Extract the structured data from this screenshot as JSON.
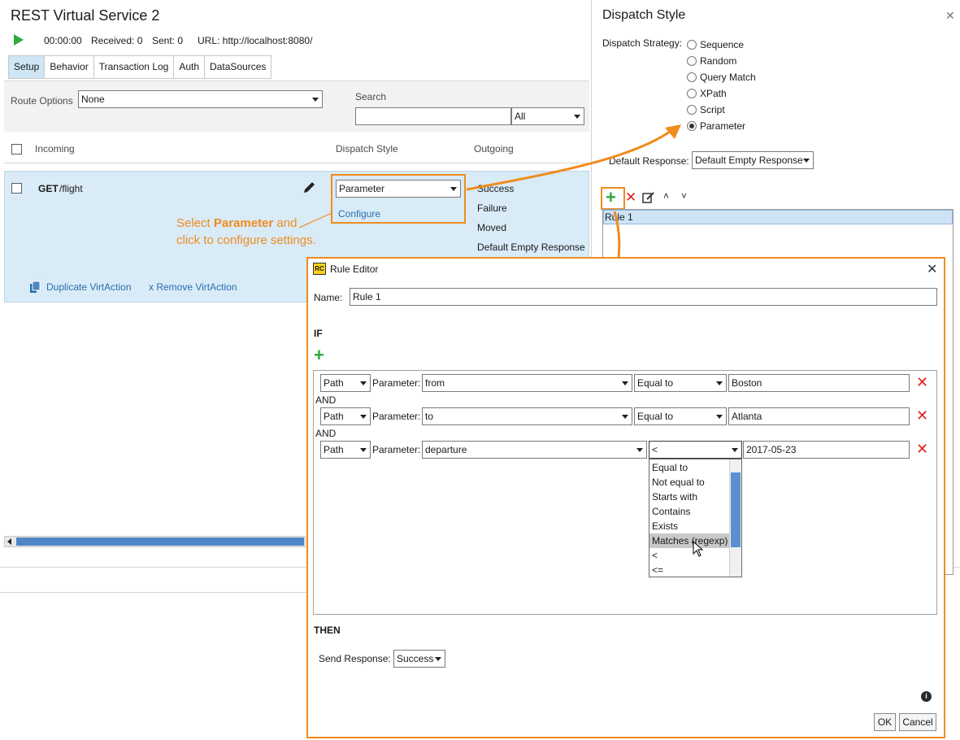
{
  "left": {
    "title": "REST Virtual Service 2",
    "status": {
      "time": "00:00:00",
      "received": "Received: 0",
      "sent": "Sent: 0",
      "url": "URL: http://localhost:8080/"
    },
    "tabs": [
      "Setup",
      "Behavior",
      "Transaction Log",
      "Auth",
      "DataSources"
    ],
    "route_options_label": "Route Options",
    "route_options_value": "None",
    "search_label": "Search",
    "search_value": "",
    "search_filter": "All",
    "columns": {
      "incoming": "Incoming",
      "dispatch": "Dispatch Style",
      "outgoing": "Outgoing"
    },
    "row": {
      "method": "GET",
      "path": "/flight",
      "dispatch_value": "Parameter",
      "configure": "Configure",
      "outgoing": [
        "Success",
        "Failure",
        "Moved",
        "Default Empty Response"
      ],
      "duplicate": "Duplicate VirtAction",
      "remove": "x Remove VirtAction"
    },
    "callout": {
      "pre": "Select ",
      "bold": "Parameter",
      "post": " and",
      "line2": "click to configure settings."
    }
  },
  "right": {
    "title": "Dispatch Style",
    "strategy_label": "Dispatch Strategy:",
    "strategies": [
      "Sequence",
      "Random",
      "Query Match",
      "XPath",
      "Script",
      "Parameter"
    ],
    "selected_strategy": "Parameter",
    "default_response_label": "Default Response:",
    "default_response_value": "Default Empty Response",
    "rules": [
      "Rule 1"
    ]
  },
  "rule_editor": {
    "title": "Rule Editor",
    "name_label": "Name:",
    "name_value": "Rule 1",
    "if_label": "IF",
    "then_label": "THEN",
    "and_label": "AND",
    "conditions": [
      {
        "source": "Path",
        "param_label": "Parameter:",
        "param": "from",
        "op": "Equal to",
        "value": "Boston"
      },
      {
        "source": "Path",
        "param_label": "Parameter:",
        "param": "to",
        "op": "Equal to",
        "value": "Atlanta"
      },
      {
        "source": "Path",
        "param_label": "Parameter:",
        "param": "departure",
        "op": "<",
        "value": "2017-05-23"
      }
    ],
    "operator_options": [
      "Equal to",
      "Not equal to",
      "Starts with",
      "Contains",
      "Exists",
      "Matches (regexp)",
      "<",
      "<="
    ],
    "hovered_option": "Matches (regexp)",
    "send_response_label": "Send Response:",
    "send_response_value": "Success",
    "ok": "OK",
    "cancel": "Cancel"
  },
  "colors": {
    "accent_orange": "#f08c1e",
    "add_green": "#2eaa3f",
    "delete_red": "#e02020",
    "selection_blue": "#cfe3f6"
  }
}
